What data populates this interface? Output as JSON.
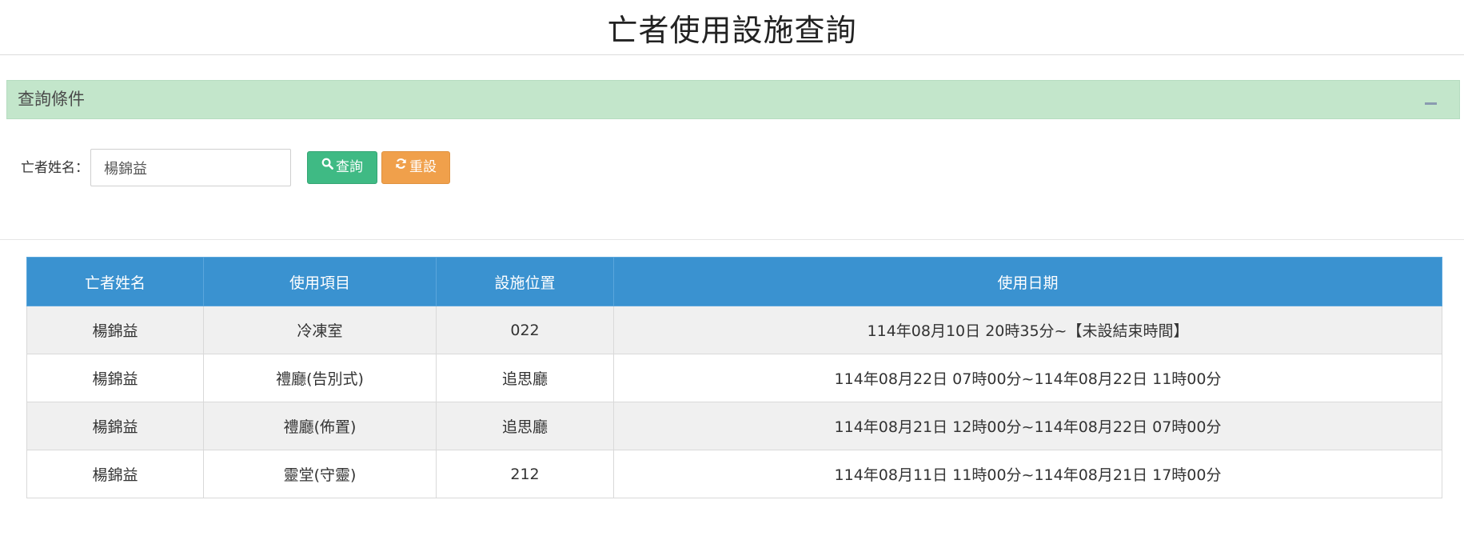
{
  "page_title": "亡者使用設施查詢",
  "panel": {
    "title": "查詢條件",
    "collapse_icon": "minus-icon"
  },
  "search": {
    "label": "亡者姓名：",
    "value": "楊錦益",
    "search_label": "查詢",
    "search_icon": "search-icon",
    "reset_label": "重設",
    "reset_icon": "refresh-icon"
  },
  "colors": {
    "panel_bg": "#c3e6cb",
    "header_bg": "#3a92d0",
    "search_btn": "#3fba84",
    "reset_btn": "#f0a04b"
  },
  "table": {
    "headers": [
      "亡者姓名",
      "使用項目",
      "設施位置",
      "使用日期"
    ],
    "rows": [
      [
        "楊錦益",
        "冷凍室",
        "022",
        "114年08月10日 20時35分~【未設結束時間】"
      ],
      [
        "楊錦益",
        "禮廳(告別式)",
        "追思廳",
        "114年08月22日 07時00分~114年08月22日 11時00分"
      ],
      [
        "楊錦益",
        "禮廳(佈置)",
        "追思廳",
        "114年08月21日 12時00分~114年08月22日 07時00分"
      ],
      [
        "楊錦益",
        "靈堂(守靈)",
        "212",
        "114年08月11日 11時00分~114年08月21日 17時00分"
      ]
    ]
  }
}
